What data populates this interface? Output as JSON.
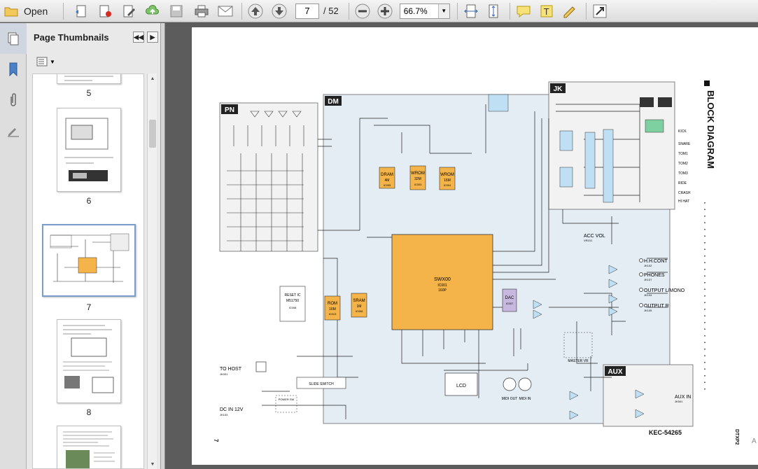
{
  "toolbar": {
    "open_label": "Open",
    "current_page": "7",
    "total_pages": "/ 52",
    "zoom": "66.7%"
  },
  "panel": {
    "title": "Page Thumbnails",
    "thumbnails": [
      {
        "label": "5"
      },
      {
        "label": "6"
      },
      {
        "label": "7"
      },
      {
        "label": "8"
      }
    ]
  },
  "diagram": {
    "title": "BLOCK DIAGRAM",
    "sections": [
      "PN",
      "DM",
      "JK",
      "AUX"
    ],
    "main_chip": {
      "name": "SWX00",
      "ref": "IC001",
      "pins": "160P"
    },
    "dac": {
      "name": "DAC",
      "ref": "IC007",
      "pins": "16P"
    },
    "memories": [
      {
        "name": "DRAM",
        "size": "4M",
        "ref": "IC005",
        "pins": "44P"
      },
      {
        "name": "WROM",
        "size": "32M",
        "ref": "IC003",
        "pins": "44P"
      },
      {
        "name": "WROM",
        "size": "16M",
        "ref": "IC004",
        "pins": "44P"
      },
      {
        "name": "ROM",
        "size": "16M",
        "ref": "IC013",
        "pins": "42P"
      },
      {
        "name": "SRAM",
        "size": "1M",
        "ref": "IC006",
        "pins": "32P"
      }
    ],
    "reset_ic": {
      "name": "RESET IC",
      "part": "M51750",
      "ref": "IC008",
      "pins": "16P"
    },
    "lcd_label": "LCD",
    "midi_out": "MIDI OUT",
    "midi_in": "MIDI IN",
    "io_labels": [
      "H.H.CONT",
      "PHONES",
      "OUTPUT L/MONO",
      "OUTPUT R",
      "ACC VOL",
      "AUX IN"
    ],
    "io_refs": [
      "JK102",
      "JK107",
      "JK104",
      "JK105",
      "VR101",
      "JK501"
    ],
    "left_labels": [
      "TO HOST",
      "DC IN 12V"
    ],
    "left_refs": [
      "JK001",
      "JK103"
    ],
    "jk_labels": [
      "KICK",
      "SNARE",
      "TOM1",
      "TOM2",
      "TOM3",
      "RIDE",
      "CRASH",
      "HI HAT"
    ],
    "slide_switch": "SLIDE SWITCH",
    "power_sw": "POWER SW",
    "master_vr": "MASTER VR",
    "page_code": "KEC-54265",
    "model": "DTXP2",
    "page_number": "7",
    "side_note": "A G"
  },
  "colors": {
    "chip_fill": "#f4b44a",
    "section_tint": "#e4ecf4",
    "jk_tint": "#f2f2f2",
    "toolbar_bg": "#e4e4e4"
  }
}
